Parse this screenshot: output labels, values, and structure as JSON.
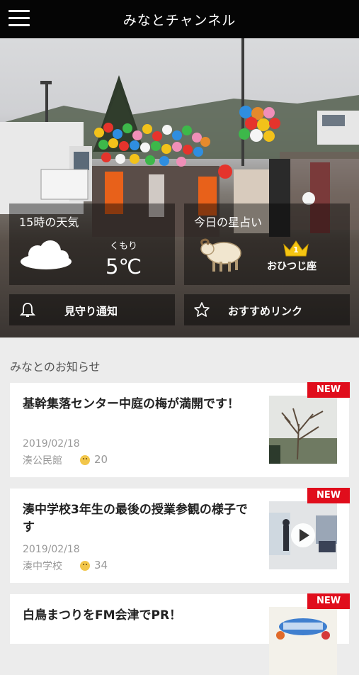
{
  "header": {
    "title": "みなとチャンネル",
    "menu_icon": "hamburger-menu-icon"
  },
  "weather": {
    "label": "15時の天気",
    "condition": "くもり",
    "temperature": "5℃",
    "icon": "cloud-icon"
  },
  "horoscope": {
    "label": "今日の星占い",
    "rank": "1",
    "sign": "おひつじ座",
    "icon": "sheep-icon"
  },
  "buttons": {
    "watch": {
      "label": "見守り通知",
      "icon": "bell-icon"
    },
    "links": {
      "label": "おすすめリンク",
      "icon": "star-icon"
    }
  },
  "news": {
    "section_title": "みなとのお知らせ",
    "badge": "NEW",
    "items": [
      {
        "title": "基幹集落センター中庭の梅が満開です！",
        "date": "2019/02/18",
        "source": "湊公民館",
        "likes": "20"
      },
      {
        "title": "湊中学校3年生の最後の授業参観の様子です",
        "date": "2019/02/18",
        "source": "湊中学校",
        "likes": "34"
      },
      {
        "title": "白鳥まつりをFM会津でPR！"
      }
    ]
  },
  "colors": {
    "badge": "#e00d1c",
    "header_bg": "#050505",
    "background": "#ececec"
  }
}
